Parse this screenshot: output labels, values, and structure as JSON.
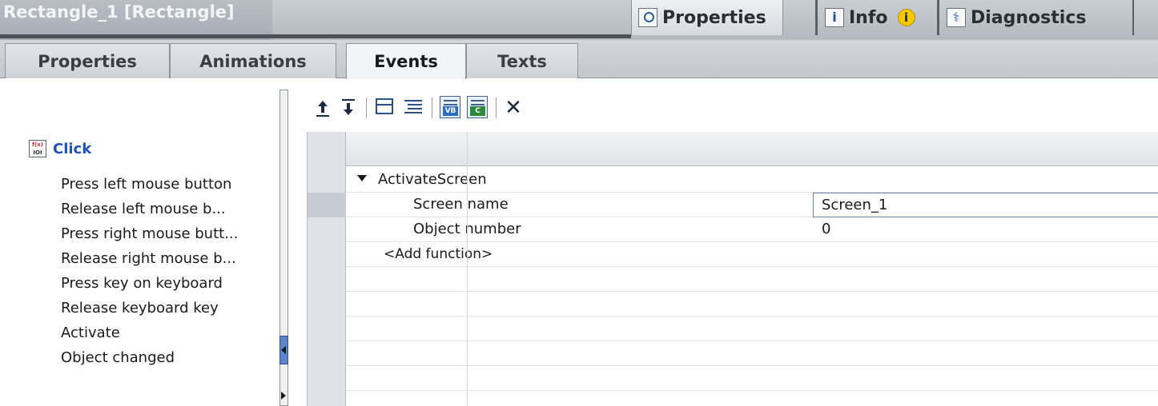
{
  "window": {
    "title": "Rectangle_1 [Rectangle]",
    "inspector_tabs": [
      {
        "label": "Properties",
        "icon": "properties-icon"
      },
      {
        "label": "Info",
        "icon": "info-icon"
      },
      {
        "label": "Diagnostics",
        "icon": "diagnostics-icon"
      }
    ],
    "info_badge": "i"
  },
  "section_tabs": [
    "Properties",
    "Animations",
    "Events",
    "Texts"
  ],
  "active_section_tab": "Events",
  "events": {
    "selected": "Click",
    "items": [
      "Press left mouse button",
      "Release left mouse b...",
      "Press right mouse butt...",
      "Release right mouse b...",
      "Press key on keyboard",
      "Release keyboard key",
      "Activate",
      "Object changed"
    ]
  },
  "toolbar": {
    "buttons": [
      "move-up-icon",
      "move-down-icon",
      "collapse-icon",
      "expand-icon",
      "vb-script-icon",
      "c-script-icon",
      "delete-icon"
    ],
    "vb_label": "VB",
    "c_label": "C",
    "delete_glyph": "✕"
  },
  "function_list": {
    "function_name": "ActivateScreen",
    "params": [
      {
        "name": "Screen name",
        "value": "Screen_1"
      },
      {
        "name": "Object number",
        "value": "0"
      }
    ],
    "add_function": "<Add function>"
  },
  "colors": {
    "selected_event": "#1e53b8",
    "scroll_thumb": "#5c84c6",
    "title_bar": "#b3b9c0"
  }
}
